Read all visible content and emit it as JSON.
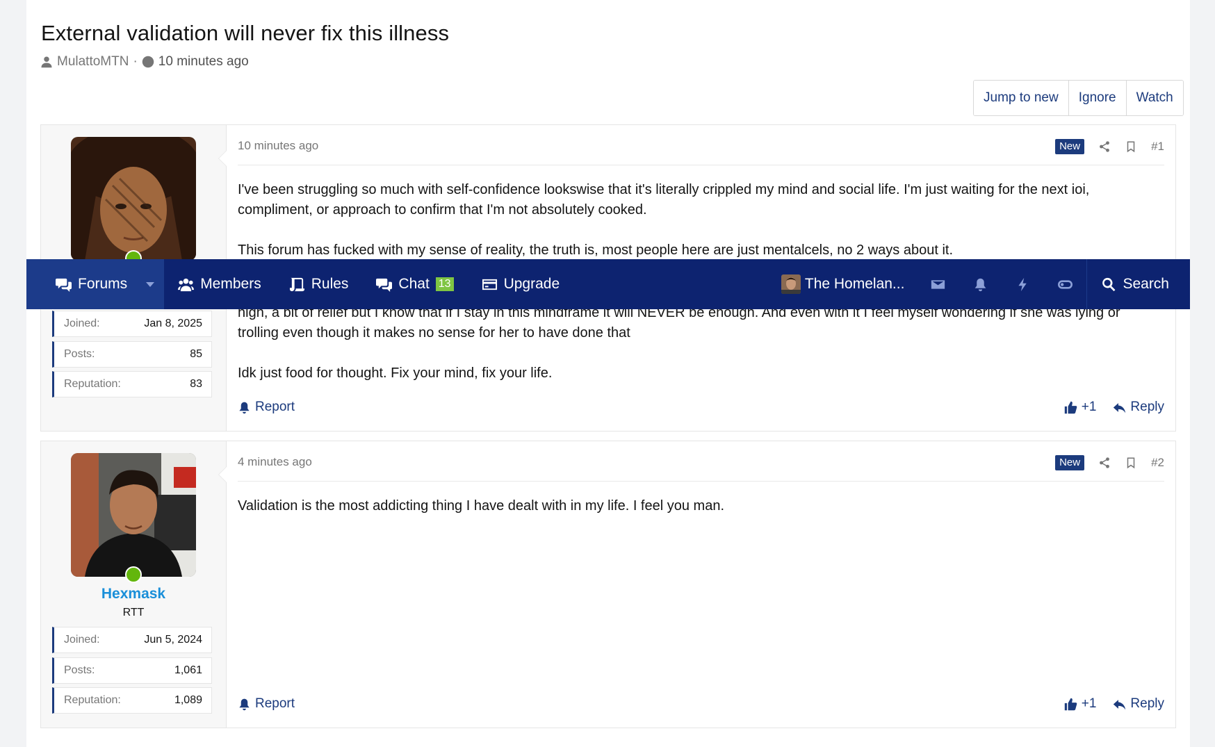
{
  "thread": {
    "title": "External validation will never fix this illness",
    "author": "MulattoMTN",
    "separator": "·",
    "time": "10 minutes ago"
  },
  "thread_buttons": {
    "jump_to_new": "Jump to new",
    "ignore": "Ignore",
    "watch": "Watch"
  },
  "navbar": {
    "forums": "Forums",
    "members": "Members",
    "rules": "Rules",
    "chat": "Chat",
    "chat_count": "13",
    "upgrade": "Upgrade",
    "user": "The Homelan...",
    "search": "Search",
    "bg_color": "#0d2370"
  },
  "posts": [
    {
      "time": "10 minutes ago",
      "badge": "New",
      "number": "#1",
      "paragraphs": [
        "I've been struggling so much with self-confidence lookswise that it's literally crippled my mind and social life. I'm just waiting for the next ioi, compliment, or approach to confirm that I'm not absolutely cooked.",
        "This forum has fucked with my sense of reality, the truth is, most people here are just mentalcels, no 2 ways about it.",
        "high, a bit of relief but I know that if I stay in this mindframe it will NEVER be enough. And even with it I feel myself wondering if she was lying or trolling even though it makes no sense for her to have done that",
        "Idk just food for thought. Fix your mind, fix your life."
      ],
      "user": {
        "stats": [
          {
            "label": "Joined:",
            "value": "Jan 8, 2025"
          },
          {
            "label": "Posts:",
            "value": "85"
          },
          {
            "label": "Reputation:",
            "value": "83"
          }
        ]
      },
      "report": "Report",
      "like": "+1",
      "reply": "Reply"
    },
    {
      "time": "4 minutes ago",
      "badge": "New",
      "number": "#2",
      "paragraphs": [
        "Validation is the most addicting thing I have dealt with in my life. I feel you man."
      ],
      "user": {
        "name": "Hexmask",
        "title": "RTT",
        "stats": [
          {
            "label": "Joined:",
            "value": "Jun 5, 2024"
          },
          {
            "label": "Posts:",
            "value": "1,061"
          },
          {
            "label": "Reputation:",
            "value": "1,089"
          }
        ]
      },
      "report": "Report",
      "like": "+1",
      "reply": "Reply"
    }
  ]
}
